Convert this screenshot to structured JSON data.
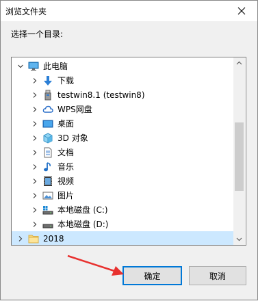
{
  "dialog": {
    "title": "浏览文件夹",
    "prompt": "选择一个目录:",
    "close_icon": "close-icon"
  },
  "tree": {
    "items": [
      {
        "label": "此电脑",
        "icon": "computer-icon",
        "expanded": true
      },
      {
        "label": "下载",
        "icon": "download-icon"
      },
      {
        "label": "testwin8.1 (testwin8)",
        "icon": "usb-drive-icon"
      },
      {
        "label": "WPS网盘",
        "icon": "cloud-icon"
      },
      {
        "label": "桌面",
        "icon": "desktop-icon"
      },
      {
        "label": "3D 对象",
        "icon": "cube-icon"
      },
      {
        "label": "文档",
        "icon": "document-icon"
      },
      {
        "label": "音乐",
        "icon": "music-icon"
      },
      {
        "label": "视频",
        "icon": "video-icon"
      },
      {
        "label": "图片",
        "icon": "picture-icon"
      },
      {
        "label": "本地磁盘 (C:)",
        "icon": "system-drive-icon"
      },
      {
        "label": "本地磁盘 (D:)",
        "icon": "drive-icon"
      },
      {
        "label": "2018",
        "icon": "folder-icon",
        "selected": true
      }
    ]
  },
  "buttons": {
    "ok": "确定",
    "cancel": "取消"
  },
  "colors": {
    "accent": "#0078d7",
    "selection": "#cce8ff",
    "annotation": "#e8312f"
  }
}
